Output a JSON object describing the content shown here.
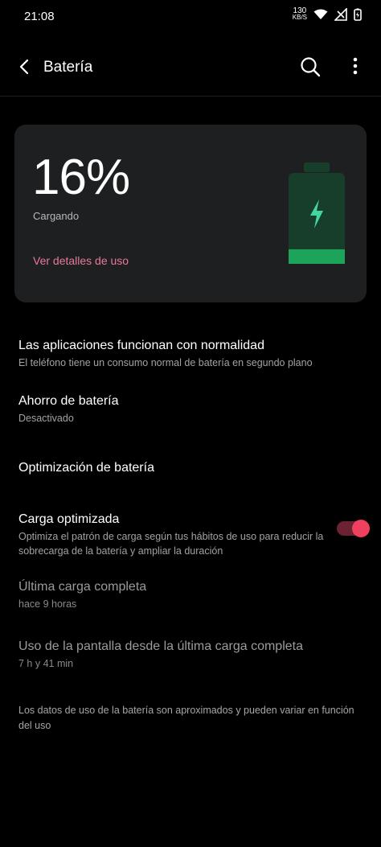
{
  "status": {
    "time": "21:08",
    "speed_value": "130",
    "speed_unit": "KB/S"
  },
  "header": {
    "title": "Batería"
  },
  "battery_card": {
    "percent": "16%",
    "state": "Cargando",
    "details_link": "Ver detalles de uso",
    "level_fraction": 0.16,
    "accent_color": "#1ea35a"
  },
  "items": [
    {
      "title": "Las aplicaciones funcionan con normalidad",
      "subtitle": "El teléfono tiene un consumo normal de batería en segundo plano"
    },
    {
      "title": "Ahorro de batería",
      "subtitle": "Desactivado"
    },
    {
      "title": "Optimización de batería",
      "subtitle": ""
    },
    {
      "title": "Carga optimizada",
      "subtitle": "Optimiza el patrón de carga según tus hábitos de uso para reducir la sobrecarga de la batería y ampliar la duración",
      "toggle_on": true
    },
    {
      "title": "Última carga completa",
      "subtitle": "hace 9 horas"
    },
    {
      "title": "Uso de la pantalla desde la última carga completa",
      "subtitle": "7 h y 41 min"
    }
  ],
  "footer": "Los datos de uso de la batería son aproximados y pueden variar en función del uso"
}
